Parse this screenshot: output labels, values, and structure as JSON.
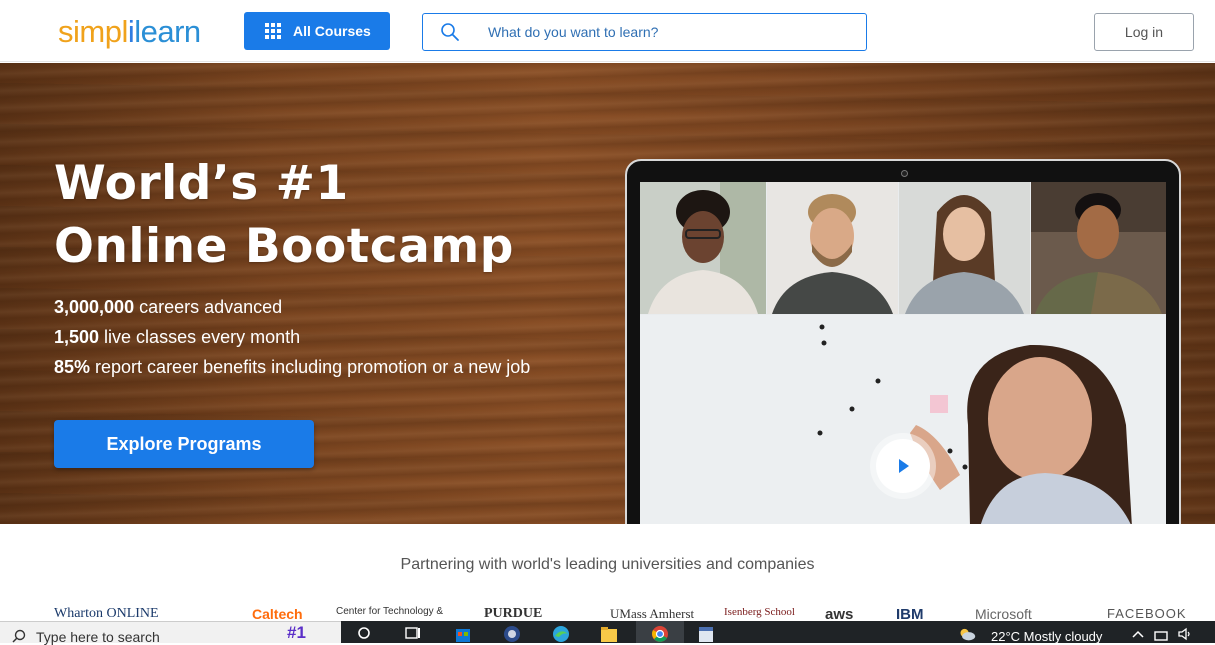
{
  "header": {
    "logo": {
      "part1": "simpl",
      "part2": "i",
      "part3": "learn"
    },
    "all_courses_label": "All Courses",
    "search_placeholder": "What do you want to learn?",
    "login_label": "Log in"
  },
  "hero": {
    "title_line1": "World’s #1",
    "title_line2": "Online Bootcamp",
    "stats": [
      {
        "value": "3,000,000",
        "text": " careers advanced"
      },
      {
        "value": "1,500",
        "text": " live classes every month"
      },
      {
        "value": "85%",
        "text": " report career benefits including promotion or a new job"
      }
    ],
    "cta_label": "Explore Programs"
  },
  "partners": {
    "title": "Partnering with world's leading universities and companies",
    "logos": [
      "Wharton ONLINE",
      "Caltech",
      "Center for Technology &",
      "PURDUE",
      "UMass Amherst",
      "Isenberg School",
      "aws",
      "IBM",
      "Microsoft",
      "FACEBOOK"
    ]
  },
  "taskbar": {
    "search_text": "Type here to search",
    "badge_text": "#1",
    "weather": "22°C  Mostly cloudy"
  },
  "colors": {
    "accent": "#1a7be8",
    "logo_orange": "#f0a21b",
    "logo_blue": "#2b8fd6"
  }
}
